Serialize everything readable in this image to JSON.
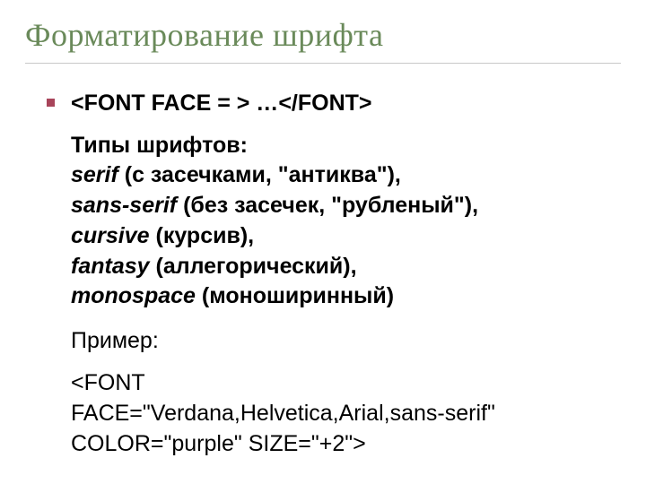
{
  "title": "Форматирование шрифта",
  "code_open": "<FONT FACE = >",
  "code_ellipsis": " …",
  "code_close": "</FONT>",
  "types_label": "Типы шрифтов:",
  "types": {
    "serif_name": "serif",
    "serif_desc": " (с засечками, \"антиква\"),",
    "sans_name": "sans-serif",
    "sans_desc": " (без засечек, \"рубленый\"),",
    "cursive_name": "cursive",
    "cursive_desc": " (курсив),",
    "fantasy_name": "fantasy",
    "fantasy_desc": " (аллегорический),",
    "mono_name": "monospace",
    "mono_desc": " (моноширинный)"
  },
  "example_label": "Пример:",
  "example_line1": "<FONT",
  "example_line2": "FACE=\"Verdana,Helvetica,Arial,sans-serif\"",
  "example_line3": "COLOR=\"purple\" SIZE=\"+2\">"
}
